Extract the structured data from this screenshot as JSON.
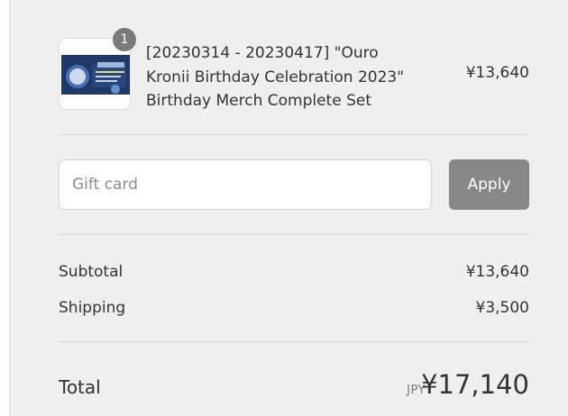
{
  "product": {
    "title": "[20230314 - 20230417] \"Ouro Kronii Birthday Celebration 2023\" Birthday Merch Complete Set",
    "price": "¥13,640",
    "quantity": "1",
    "thumbnail_icon": "product-image"
  },
  "gift_card": {
    "placeholder": "Gift card",
    "apply_label": "Apply"
  },
  "summary": {
    "subtotal_label": "Subtotal",
    "subtotal_value": "¥13,640",
    "shipping_label": "Shipping",
    "shipping_value": "¥3,500"
  },
  "total": {
    "label": "Total",
    "currency": "JPY",
    "amount": "¥17,140"
  },
  "colors": {
    "panel_bg": "#efefef",
    "button_bg": "#878787",
    "badge_bg": "#7a7a7a"
  }
}
